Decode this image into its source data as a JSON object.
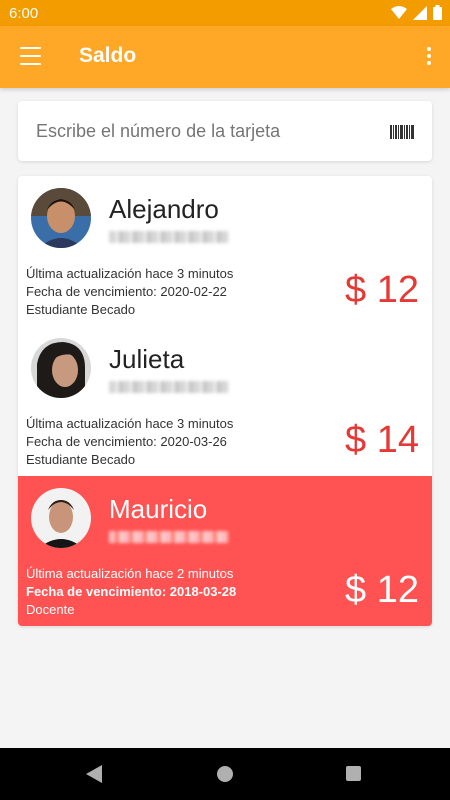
{
  "status_bar": {
    "time": "6:00"
  },
  "app_bar": {
    "title": "Saldo"
  },
  "search": {
    "placeholder": "Escribe el número de la tarjeta"
  },
  "cards": [
    {
      "name": "Alejandro",
      "updated": "Última actualización hace 3 minutos",
      "expiry": "Fecha de vencimiento: 2020-02-22",
      "role": "Estudiante Becado",
      "amount": "$ 12",
      "highlighted": false
    },
    {
      "name": "Julieta",
      "updated": "Última actualización hace 3 minutos",
      "expiry": "Fecha de vencimiento: 2020-03-26",
      "role": "Estudiante Becado",
      "amount": "$ 14",
      "highlighted": false
    },
    {
      "name": "Mauricio",
      "updated": "Última actualización hace 2 minutos",
      "expiry": "Fecha de vencimiento: 2018-03-28",
      "role": "Docente",
      "amount": "$ 12",
      "highlighted": true
    }
  ],
  "colors": {
    "status_bar": "#f39c00",
    "app_bar": "#ffa726",
    "highlight": "#ff5252",
    "amount": "#e53935"
  }
}
